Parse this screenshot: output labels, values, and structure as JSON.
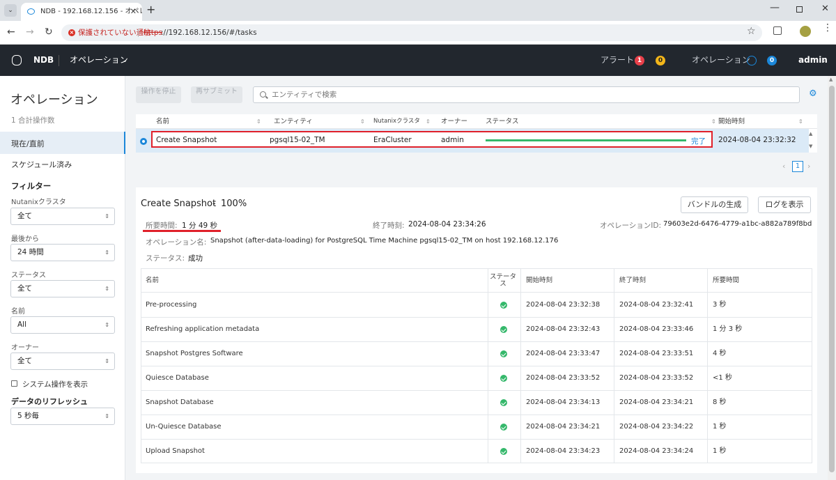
{
  "browser": {
    "tab_title": "NDB - 192.168.12.156 - オペレー",
    "insecure_label": "保護されていない通信",
    "url_scheme": "https",
    "url_rest": "://192.168.12.156/#/tasks"
  },
  "header": {
    "app_name": "NDB",
    "menu": "オペレーション",
    "alerts_label": "アラート",
    "alerts_red": "1",
    "alerts_yellow": "0",
    "operations_label": "オペレーション",
    "operations_count": "0",
    "user": "admin"
  },
  "sidebar": {
    "title": "オペレーション",
    "subtitle": "1 合計操作数",
    "nav": [
      {
        "label": "現在/直前",
        "active": true
      },
      {
        "label": "スケジュール済み",
        "active": false
      }
    ],
    "filter_title": "フィルター",
    "filters": [
      {
        "label": "Nutanixクラスタ",
        "value": "全て"
      },
      {
        "label": "最後から",
        "value": "24 時間"
      },
      {
        "label": "ステータス",
        "value": "全て"
      },
      {
        "label": "名前",
        "value": "All"
      },
      {
        "label": "オーナー",
        "value": "全て"
      }
    ],
    "show_system_label": "システム操作を表示",
    "refresh_title": "データのリフレッシュ",
    "refresh_value": "5 秒毎"
  },
  "toolbar": {
    "stop_label": "操作を停止",
    "resubmit_label": "再サブミット",
    "search_placeholder": "エンティティで検索"
  },
  "ops_table": {
    "columns": [
      "名前",
      "エンティティ",
      "Nutanixクラスタ",
      "オーナー",
      "ステータス",
      "開始時刻"
    ],
    "row": {
      "name": "Create Snapshot",
      "entity": "pgsql15-02_TM",
      "cluster": "EraCluster",
      "owner": "admin",
      "status": "完了",
      "progress": 1.0,
      "start": "2024-08-04 23:32:32"
    },
    "page": "1"
  },
  "detail": {
    "title": "Create Snapshot",
    "percent": "100%",
    "bundle_button": "バンドルの生成",
    "log_button": "ログを表示",
    "duration_label": "所要時間:",
    "duration_value": "1 分 49 秒",
    "end_label": "終了時刻:",
    "end_value": "2024-08-04 23:34:26",
    "opid_label": "オペレーションID:",
    "opid_value": "79603e2d-6476-4779-a1bc-a882a789f8bd",
    "opname_label": "オペレーション名:",
    "opname_value": "Snapshot (after-data-loading) for PostgreSQL Time Machine pgsql15-02_TM on host 192.168.12.176",
    "status_label": "ステータス:",
    "status_value": "成功",
    "columns": [
      "名前",
      "ステータス",
      "開始時刻",
      "終了時刻",
      "所要時間"
    ],
    "steps": [
      {
        "name": "Pre-processing",
        "start": "2024-08-04 23:32:38",
        "end": "2024-08-04 23:32:41",
        "duration": "3 秒"
      },
      {
        "name": "Refreshing application metadata",
        "start": "2024-08-04 23:32:43",
        "end": "2024-08-04 23:33:46",
        "duration": "1 分 3 秒"
      },
      {
        "name": "Snapshot Postgres Software",
        "start": "2024-08-04 23:33:47",
        "end": "2024-08-04 23:33:51",
        "duration": "4 秒"
      },
      {
        "name": "Quiesce Database",
        "start": "2024-08-04 23:33:52",
        "end": "2024-08-04 23:33:52",
        "duration": "<1 秒"
      },
      {
        "name": "Snapshot Database",
        "start": "2024-08-04 23:34:13",
        "end": "2024-08-04 23:34:21",
        "duration": "8 秒"
      },
      {
        "name": "Un-Quiesce Database",
        "start": "2024-08-04 23:34:21",
        "end": "2024-08-04 23:34:22",
        "duration": "1 秒"
      },
      {
        "name": "Upload Snapshot",
        "start": "2024-08-04 23:34:23",
        "end": "2024-08-04 23:34:24",
        "duration": "1 秒"
      }
    ]
  },
  "colors": {
    "header_bg": "#22272e",
    "accent": "#1b87d9",
    "highlight": "#e0202a",
    "success": "#35b86b"
  }
}
